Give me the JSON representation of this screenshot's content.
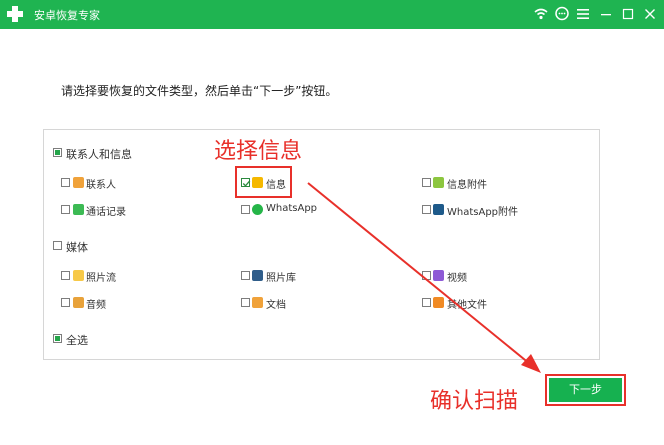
{
  "titlebar": {
    "title": "安卓恢复专家",
    "color": "#1fb451"
  },
  "instruction": "请选择要恢复的文件类型，然后单击“下一步”按钮。",
  "groups": {
    "contacts_messages": {
      "label": "联系人和信息",
      "items": {
        "contacts": "联系人",
        "messages": "信息",
        "message_attachments": "信息附件",
        "call_log": "通话记录",
        "whatsapp": "WhatsApp",
        "whatsapp_attachments": "WhatsApp附件"
      }
    },
    "media": {
      "label": "媒体",
      "items": {
        "photo_stream": "照片流",
        "photo_library": "照片库",
        "videos": "视频",
        "audio": "音频",
        "documents": "文档",
        "other_files": "其他文件"
      }
    }
  },
  "select_all": "全选",
  "annotations": {
    "select_info": "选择信息",
    "confirm_scan": "确认扫描",
    "color": "#e8302a"
  },
  "next_button": "下一步"
}
